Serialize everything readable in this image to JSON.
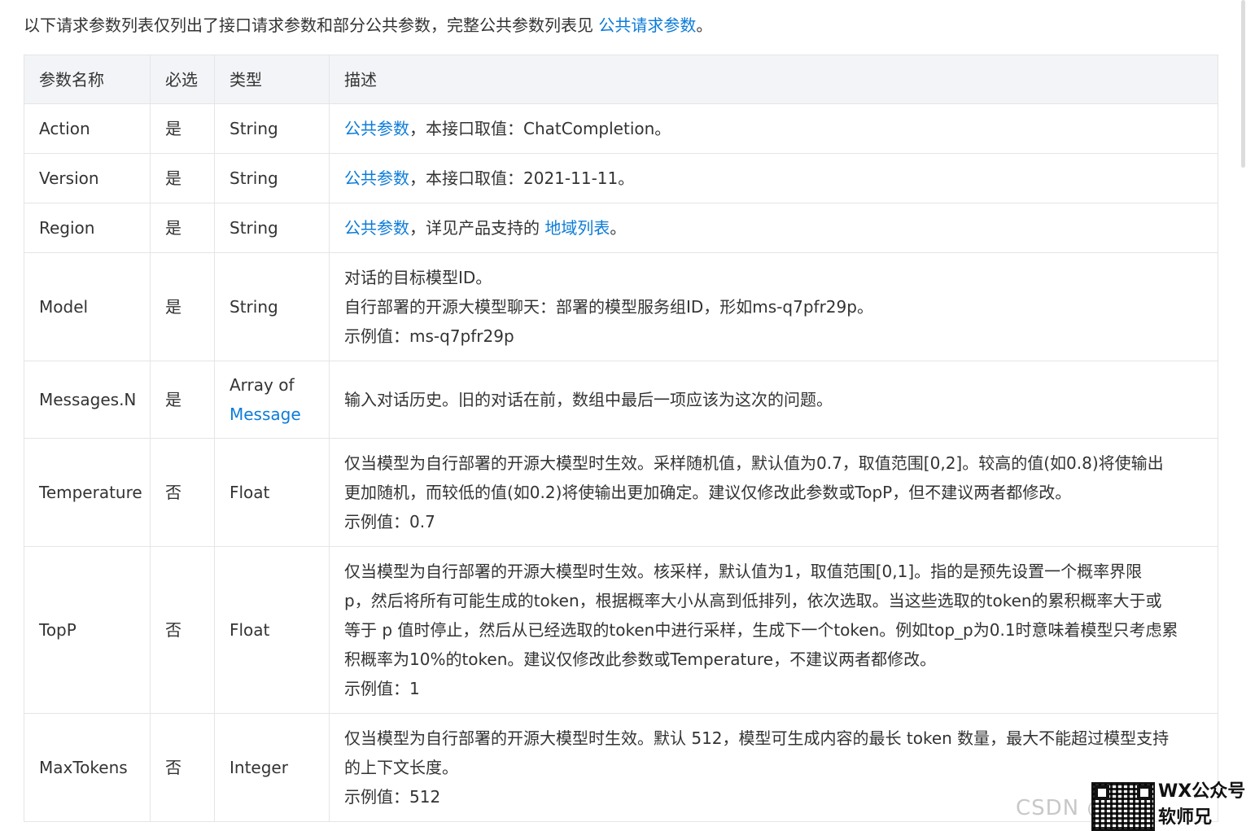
{
  "intro": {
    "text": "以下请求参数列表仅列出了接口请求参数和部分公共参数，完整公共参数列表见 ",
    "link": "公共请求参数",
    "end": "。"
  },
  "table": {
    "headers": [
      "参数名称",
      "必选",
      "类型",
      "描述"
    ],
    "rows": [
      {
        "name": "Action",
        "required": "是",
        "type": "String",
        "link": "公共参数",
        "text": "，本接口取值：ChatCompletion。"
      },
      {
        "name": "Version",
        "required": "是",
        "type": "String",
        "link": "公共参数",
        "text": "，本接口取值：2021-11-11。"
      },
      {
        "name": "Region",
        "required": "是",
        "type": "String",
        "link": "公共参数",
        "text": "，详见产品支持的 ",
        "link2": "地域列表",
        "end": "。"
      },
      {
        "name": "Model",
        "required": "是",
        "type": "String",
        "lines": [
          "对话的目标模型ID。",
          "自行部署的开源大模型聊天：部署的模型服务组ID，形如ms-q7pfr29p。",
          "示例值：ms-q7pfr29p"
        ]
      },
      {
        "name": "Messages.N",
        "required": "是",
        "type": "Array of",
        "type_link": "Message",
        "lines": [
          "输入对话历史。旧的对话在前，数组中最后一项应该为这次的问题。"
        ]
      },
      {
        "name": "Temperature",
        "required": "否",
        "type": "Float",
        "lines": [
          "仅当模型为自行部署的开源大模型时生效。采样随机值，默认值为0.7，取值范围[0,2]。较高的值(如0.8)将使输出",
          "更加随机，而较低的值(如0.2)将使输出更加确定。建议仅修改此参数或TopP，但不建议两者都修改。",
          "示例值：0.7"
        ]
      },
      {
        "name": "TopP",
        "required": "否",
        "type": "Float",
        "lines": [
          "仅当模型为自行部署的开源大模型时生效。核采样，默认值为1，取值范围[0,1]。指的是预先设置一个概率界限",
          "p，然后将所有可能生成的token，根据概率大小从高到低排列，依次选取。当这些选取的token的累积概率大于或",
          "等于 p 值时停止，然后从已经选取的token中进行采样，生成下一个token。例如top_p为0.1时意味着模型只考虑累",
          "积概率为10%的token。建议仅修改此参数或Temperature，不建议两者都修改。",
          "示例值：1"
        ]
      },
      {
        "name": "MaxTokens",
        "required": "否",
        "type": "Integer",
        "lines": [
          "仅当模型为自行部署的开源大模型时生效。默认 512，模型可生成内容的最长 token 数量，最大不能超过模型支持",
          "的上下文长度。",
          "示例值：512"
        ]
      }
    ]
  },
  "overlay": {
    "watermark": "CSDN @",
    "wx_line1": "WX公众号",
    "wx_line2": "软师兄"
  }
}
